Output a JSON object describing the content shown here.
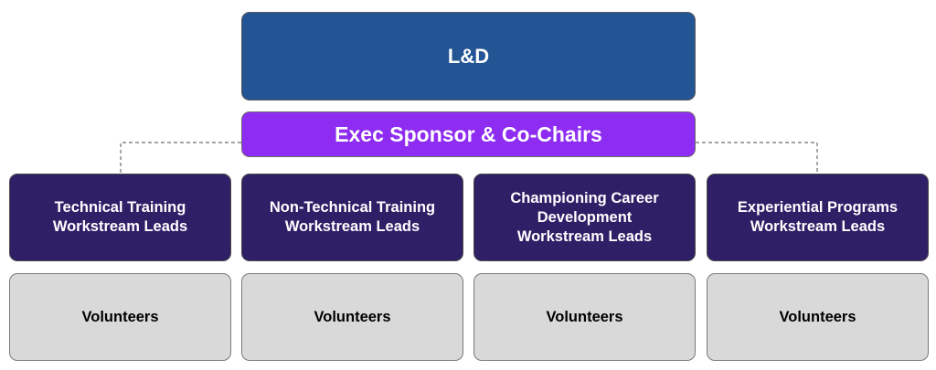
{
  "top": {
    "label": "L&D"
  },
  "sponsor": {
    "label": "Exec Sponsor & Co-Chairs"
  },
  "leads": [
    {
      "label": "Technical Training\nWorkstream Leads"
    },
    {
      "label": "Non-Technical Training\nWorkstream Leads"
    },
    {
      "label": "Championing Career\nDevelopment\nWorkstream Leads"
    },
    {
      "label": "Experiential Programs\nWorkstream Leads"
    }
  ],
  "volunteers": [
    {
      "label": "Volunteers"
    },
    {
      "label": "Volunteers"
    },
    {
      "label": "Volunteers"
    },
    {
      "label": "Volunteers"
    }
  ],
  "colors": {
    "top": "#235494",
    "sponsor": "#8e2cf2",
    "leads": "#2f1f67",
    "volunteers": "#d9d9d9"
  }
}
